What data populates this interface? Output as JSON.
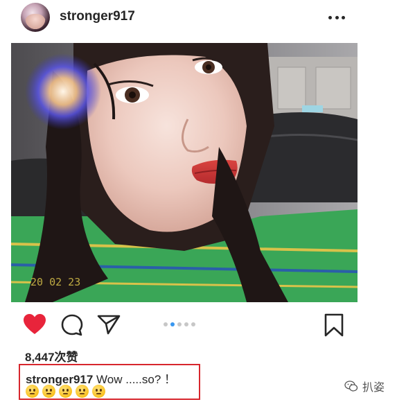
{
  "post": {
    "username": "stronger917",
    "photo_date_stamp": "20 02 23",
    "likes": "8,447次赞",
    "caption_user": "stronger917",
    "caption_text": " Wow .....so? ！",
    "emoji_count": 5,
    "carousel_active_index": 1,
    "carousel_count": 5
  },
  "watermark": {
    "text": "扒姿"
  },
  "colors": {
    "heart": "#e8243b",
    "caption_border": "#d7262d",
    "carousel_active": "#3897f0"
  },
  "icons": [
    "more-options-icon",
    "heart-icon",
    "comment-icon",
    "share-icon",
    "bookmark-icon",
    "wechat-icon"
  ]
}
